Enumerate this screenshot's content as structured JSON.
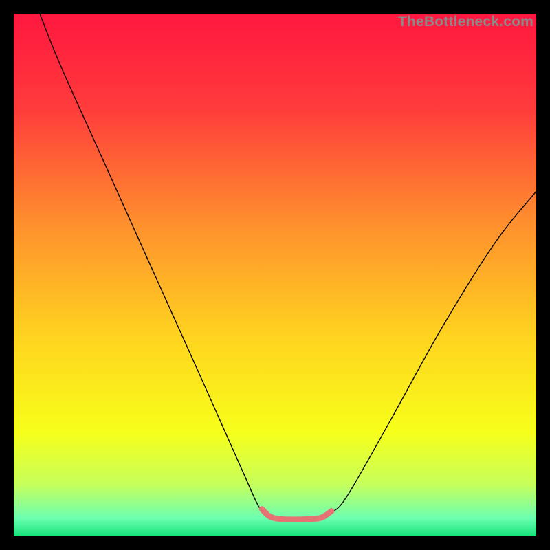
{
  "watermark": "TheBottleneck.com",
  "chart_data": {
    "type": "line",
    "title": "",
    "xlabel": "",
    "ylabel": "",
    "xlim": [
      0,
      100
    ],
    "ylim": [
      0,
      100
    ],
    "gradient_stops": [
      {
        "offset": 0.0,
        "color": "#ff173f"
      },
      {
        "offset": 0.18,
        "color": "#ff3b3b"
      },
      {
        "offset": 0.4,
        "color": "#ff8f2e"
      },
      {
        "offset": 0.62,
        "color": "#ffd41f"
      },
      {
        "offset": 0.8,
        "color": "#f7ff1a"
      },
      {
        "offset": 0.9,
        "color": "#c7ff5a"
      },
      {
        "offset": 0.965,
        "color": "#6dffb0"
      },
      {
        "offset": 1.0,
        "color": "#16e37a"
      }
    ],
    "series": [
      {
        "name": "curve",
        "stroke": "#000000",
        "stroke_width": 1.4,
        "points": [
          {
            "x": 5.0,
            "y": 100.0
          },
          {
            "x": 9.0,
            "y": 90.0
          },
          {
            "x": 18.0,
            "y": 70.0
          },
          {
            "x": 27.0,
            "y": 50.0
          },
          {
            "x": 36.0,
            "y": 30.0
          },
          {
            "x": 44.0,
            "y": 12.0
          },
          {
            "x": 47.0,
            "y": 5.5
          },
          {
            "x": 49.0,
            "y": 3.6
          },
          {
            "x": 52.0,
            "y": 3.2
          },
          {
            "x": 56.0,
            "y": 3.2
          },
          {
            "x": 59.0,
            "y": 3.5
          },
          {
            "x": 61.0,
            "y": 4.6
          },
          {
            "x": 64.0,
            "y": 8.0
          },
          {
            "x": 72.0,
            "y": 22.0
          },
          {
            "x": 82.0,
            "y": 40.0
          },
          {
            "x": 92.0,
            "y": 56.0
          },
          {
            "x": 100.0,
            "y": 66.0
          }
        ]
      },
      {
        "name": "valley-highlight",
        "stroke": "#e57373",
        "stroke_width": 8.5,
        "points": [
          {
            "x": 47.5,
            "y": 5.2
          },
          {
            "x": 49.0,
            "y": 3.8
          },
          {
            "x": 51.0,
            "y": 3.3
          },
          {
            "x": 54.0,
            "y": 3.2
          },
          {
            "x": 57.0,
            "y": 3.3
          },
          {
            "x": 59.0,
            "y": 3.6
          },
          {
            "x": 60.8,
            "y": 4.8
          }
        ]
      }
    ]
  }
}
